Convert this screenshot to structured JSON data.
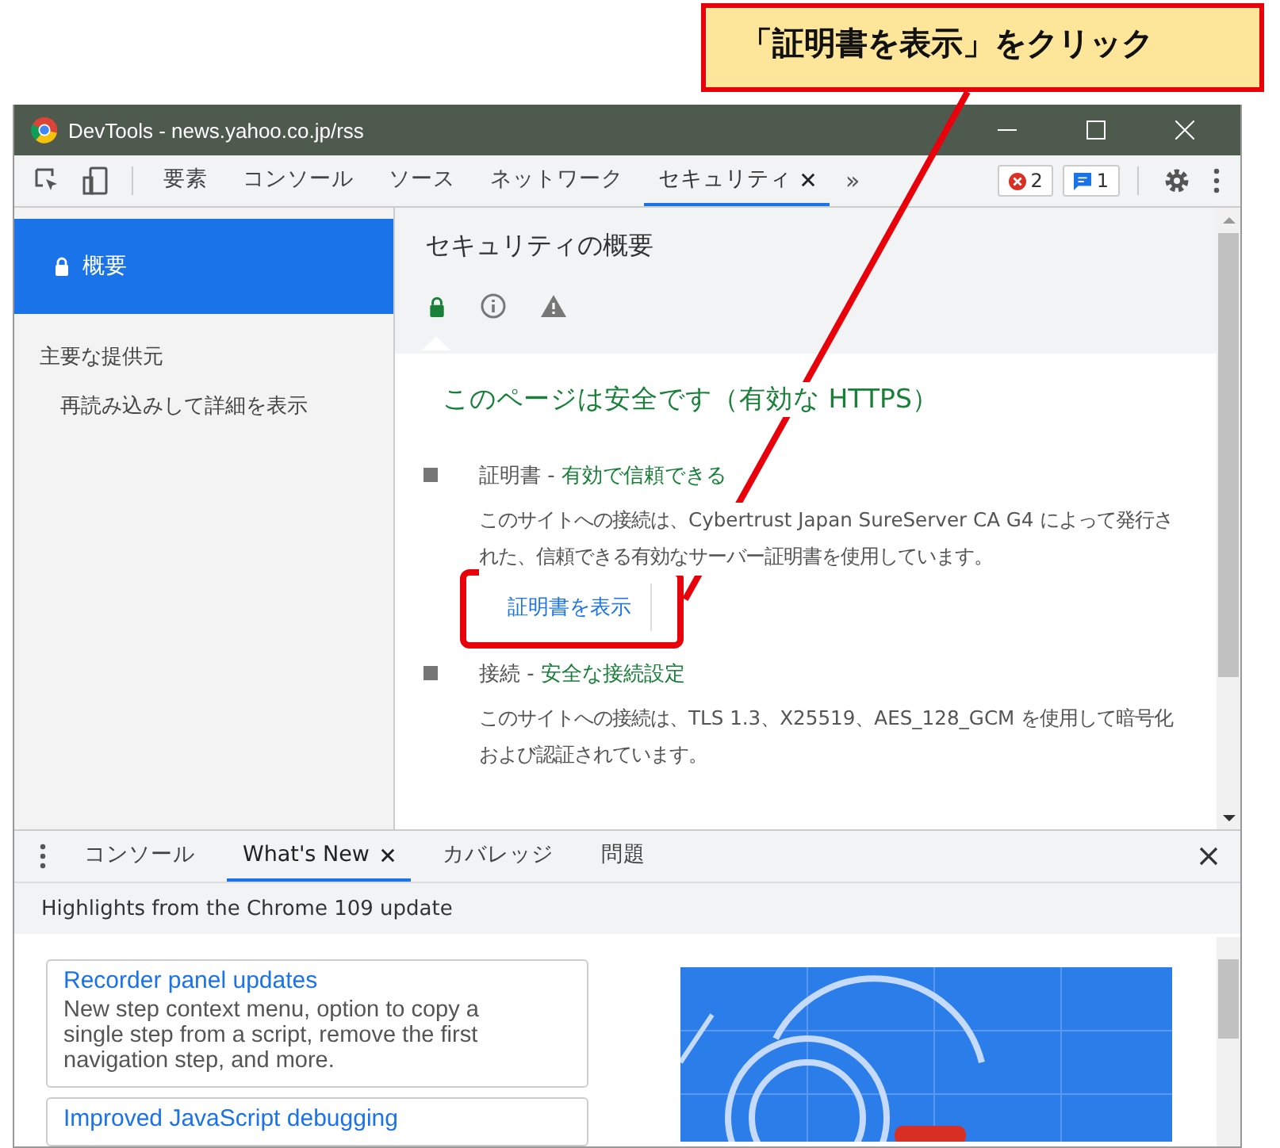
{
  "callout": {
    "text": "「証明書を表示」をクリック"
  },
  "window": {
    "title": "DevTools - news.yahoo.co.jp/rss"
  },
  "toolbar": {
    "tabs": [
      {
        "label": "要素",
        "selected": false
      },
      {
        "label": "コンソール",
        "selected": false
      },
      {
        "label": "ソース",
        "selected": false
      },
      {
        "label": "ネットワーク",
        "selected": false
      },
      {
        "label": "セキュリティ",
        "selected": true
      }
    ],
    "more": "»",
    "errors": "2",
    "messages": "1"
  },
  "sidebar": {
    "items": [
      {
        "label": "概要",
        "selected": true
      }
    ],
    "section_title": "主要な提供元",
    "reload_text": "再読み込みして詳細を表示"
  },
  "overview": {
    "title": "セキュリティの概要",
    "status_icons": [
      {
        "kind": "lock",
        "selected": true
      },
      {
        "kind": "info",
        "selected": false
      },
      {
        "kind": "warning",
        "selected": false
      }
    ],
    "headline": "このページは安全です（有効な HTTPS）",
    "sections": [
      {
        "title": "証明書",
        "separator": "-",
        "status": "有効で信頼できる",
        "description": "このサイトへの接続は、Cybertrust Japan SureServer CA G4 によって発行された、信頼できる有効なサーバー証明書を使用しています。",
        "button": "証明書を表示"
      },
      {
        "title": "接続",
        "separator": "-",
        "status": "安全な接続設定",
        "description": "このサイトへの接続は、TLS 1.3、X25519、AES_128_GCM を使用して暗号化および認証されています。"
      }
    ]
  },
  "drawer": {
    "tabs": [
      {
        "label": "コンソール",
        "selected": false
      },
      {
        "label": "What's New",
        "selected": true
      },
      {
        "label": "カバレッジ",
        "selected": false
      },
      {
        "label": "問題",
        "selected": false
      }
    ],
    "banner": "Highlights from the Chrome 109 update",
    "cards": [
      {
        "title": "Recorder panel updates",
        "body": "New step context menu, option to copy a single step from a script, remove the first navigation step, and more."
      },
      {
        "title": "Improved JavaScript debugging"
      }
    ]
  }
}
